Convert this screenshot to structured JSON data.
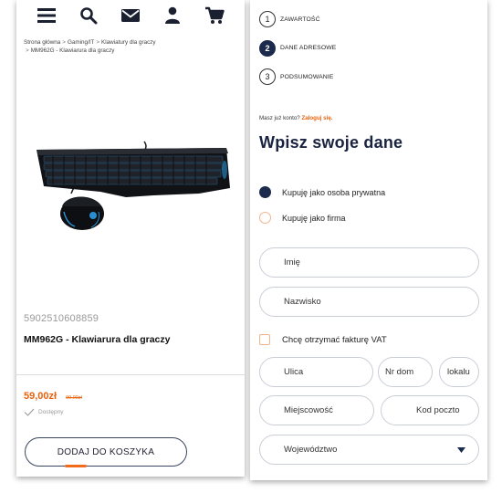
{
  "top_nav": {
    "icons": [
      "menu-icon",
      "search-icon",
      "mail-icon",
      "user-icon",
      "cart-icon"
    ]
  },
  "breadcrumb": {
    "items": [
      "Strona główna",
      "Gaming/IT",
      "Klawiatury dla graczy",
      "MM962G - Klawiarura dla graczy"
    ],
    "separator": ">"
  },
  "product": {
    "ean": "5902510608859",
    "name": "MM962G - Klawiarura dla graczy",
    "price": "59,00zł",
    "old_price": "99,00zł",
    "availability": "Dostępny",
    "add_to_cart_label": "DODAJ DO KOSZYKA"
  },
  "checkout": {
    "steps": [
      {
        "number": "1",
        "label": "ZAWARTOŚĆ"
      },
      {
        "number": "2",
        "label": "DANE ADRESOWE"
      },
      {
        "number": "3",
        "label": "PODSUMOWANIE"
      }
    ],
    "active_step": 2,
    "login_prompt": "Masz już konto?",
    "login_link": "Zaloguj się.",
    "title": "Wpisz swoje dane",
    "buyer_types": [
      {
        "label": "Kupuję jako osoba prywatna",
        "selected": true
      },
      {
        "label": "Kupuję jako firma",
        "selected": false
      }
    ],
    "fields": {
      "first_name": "Imię",
      "last_name": "Nazwisko",
      "street": "Ulica",
      "house_number": "Nr dom",
      "flat_number": "lokalu",
      "city": "Miejscowość",
      "postal_code": "Kod poczto",
      "region": "Województwo"
    },
    "vat_invoice_label": "Chcę otrzymać fakturę VAT",
    "vat_invoice_checked": false
  },
  "colors": {
    "navy": "#1c2b4d",
    "accent_orange": "#e8620e",
    "field_border": "#c9cdd6",
    "radio_border": "#f2b48a"
  }
}
